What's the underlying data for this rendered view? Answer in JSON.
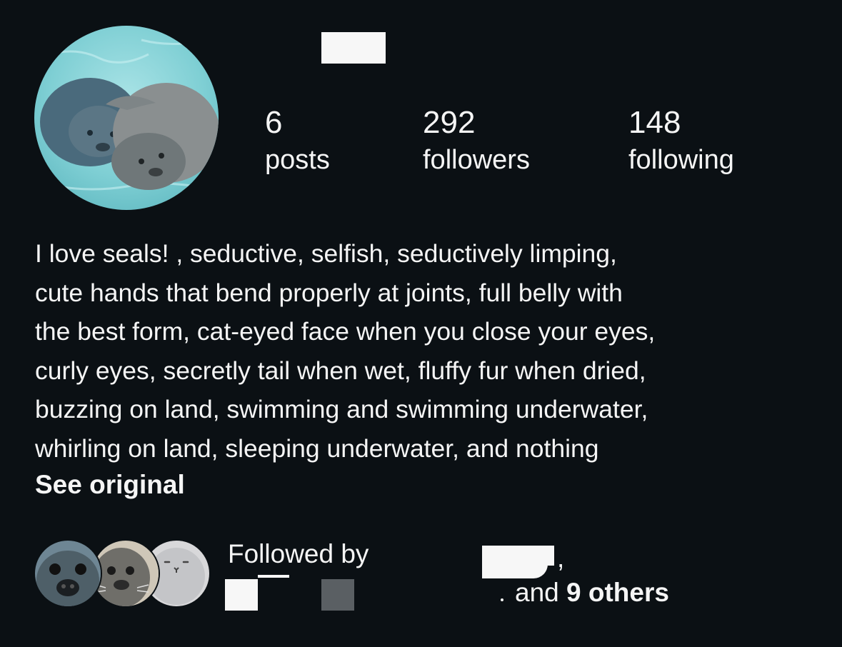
{
  "profile": {
    "stats": {
      "posts": {
        "count": "6",
        "label": "posts"
      },
      "followers": {
        "count": "292",
        "label": "followers"
      },
      "following": {
        "count": "148",
        "label": "following"
      }
    },
    "bio_lines": [
      "I love seals! , seductive, selfish, seductively limping,",
      "cute hands that bend properly at joints, full belly with",
      "the best form, cat-eyed face when you close your eyes,",
      "curly eyes, secretly tail when wet, fluffy fur when dried,",
      "buzzing on land, swimming and swimming underwater,",
      "whirling on land, sleeping underwater, and nothing"
    ],
    "see_original_label": "See original"
  },
  "followed_by": {
    "prefix": "Followed by",
    "comma": ",",
    "and_label": "and",
    "others_label": "9 others"
  },
  "colors": {
    "background": "#0b1014",
    "text": "#f5f5f5",
    "redaction": "#f7f7f7"
  },
  "icons": {
    "profile_avatar": "seal-photo-avatar",
    "follower_avatars": [
      "seal-face-avatar",
      "seal-face-avatar",
      "seal-plush-avatar"
    ]
  }
}
